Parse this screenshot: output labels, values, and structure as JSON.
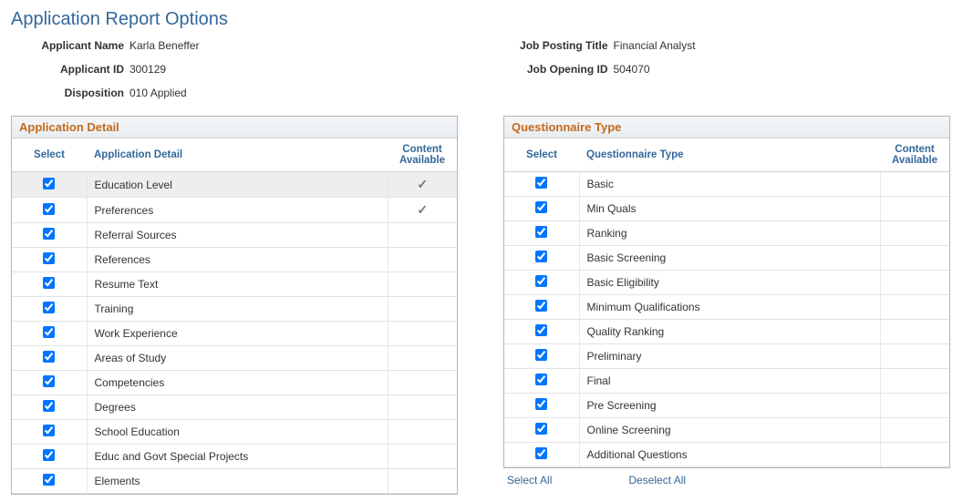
{
  "title": "Application Report Options",
  "header": {
    "left": {
      "applicant_name_label": "Applicant Name",
      "applicant_name": "Karla Beneffer",
      "applicant_id_label": "Applicant ID",
      "applicant_id": "300129",
      "disposition_label": "Disposition",
      "disposition": "010 Applied"
    },
    "right": {
      "job_posting_title_label": "Job Posting Title",
      "job_posting_title": "Financial Analyst",
      "job_opening_id_label": "Job Opening ID",
      "job_opening_id": "504070"
    }
  },
  "app_detail": {
    "panel_title": "Application Detail",
    "col_select": "Select",
    "col_detail": "Application Detail",
    "col_content": "Content Available",
    "rows": [
      {
        "label": "Education Level",
        "checked": true,
        "content": true,
        "hl": true
      },
      {
        "label": "Preferences",
        "checked": true,
        "content": true
      },
      {
        "label": "Referral Sources",
        "checked": true,
        "content": false
      },
      {
        "label": "References",
        "checked": true,
        "content": false
      },
      {
        "label": "Resume Text",
        "checked": true,
        "content": false
      },
      {
        "label": "Training",
        "checked": true,
        "content": false
      },
      {
        "label": "Work Experience",
        "checked": true,
        "content": false
      },
      {
        "label": "Areas of Study",
        "checked": true,
        "content": false
      },
      {
        "label": "Competencies",
        "checked": true,
        "content": false
      },
      {
        "label": "Degrees",
        "checked": true,
        "content": false
      },
      {
        "label": "School Education",
        "checked": true,
        "content": false
      },
      {
        "label": "Educ and Govt Special Projects",
        "checked": true,
        "content": false
      },
      {
        "label": "Elements",
        "checked": true,
        "content": false
      }
    ]
  },
  "q_type": {
    "panel_title": "Questionnaire Type",
    "col_select": "Select",
    "col_type": "Questionnaire Type",
    "col_content": "Content Available",
    "rows": [
      {
        "label": "Basic",
        "checked": true
      },
      {
        "label": "Min Quals",
        "checked": true
      },
      {
        "label": "Ranking",
        "checked": true
      },
      {
        "label": "Basic Screening",
        "checked": true
      },
      {
        "label": "Basic Eligibility",
        "checked": true
      },
      {
        "label": "Minimum Qualifications",
        "checked": true
      },
      {
        "label": "Quality Ranking",
        "checked": true
      },
      {
        "label": "Preliminary",
        "checked": true
      },
      {
        "label": "Final",
        "checked": true
      },
      {
        "label": "Pre Screening",
        "checked": true
      },
      {
        "label": "Online Screening",
        "checked": true
      },
      {
        "label": "Additional Questions",
        "checked": true
      }
    ],
    "select_all": "Select All",
    "deselect_all": "Deselect All"
  }
}
